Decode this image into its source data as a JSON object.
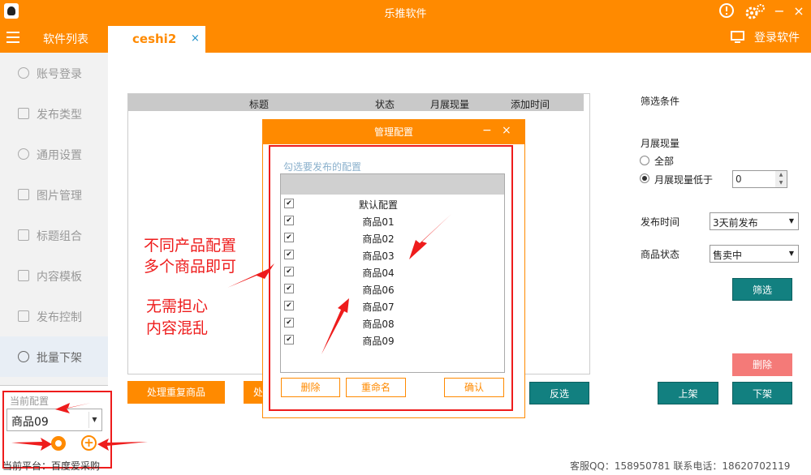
{
  "window": {
    "title": "乐推软件"
  },
  "tabbar": {
    "software_list": "软件列表",
    "active_tab": "ceshi2",
    "tab_close": "×",
    "login": "登录软件"
  },
  "sidebar": {
    "items": [
      {
        "label": "账号登录",
        "icon": "user-icon"
      },
      {
        "label": "发布类型",
        "icon": "list-icon"
      },
      {
        "label": "通用设置",
        "icon": "gear-icon"
      },
      {
        "label": "图片管理",
        "icon": "image-icon"
      },
      {
        "label": "标题组合",
        "icon": "document-icon"
      },
      {
        "label": "内容模板",
        "icon": "template-icon"
      },
      {
        "label": "发布控制",
        "icon": "send-icon"
      },
      {
        "label": "批量下架",
        "icon": "search-icon"
      }
    ],
    "current_config_label": "当前配置",
    "current_config_value": "商品09"
  },
  "table": {
    "columns": [
      "标题",
      "状态",
      "月展现量",
      "添加时间"
    ]
  },
  "buttons": {
    "process_duplicates": "处理重复商品",
    "partial_button": "处",
    "invert": "反选",
    "list_on": "上架",
    "list_off": "下架",
    "delete": "删除",
    "filter": "筛选"
  },
  "filter": {
    "title": "筛选条件",
    "monthly_label": "月展现量",
    "radio_all": "全部",
    "radio_below": "月展现量低于",
    "below_value": "0",
    "publish_time_label": "发布时间",
    "publish_time_value": "3天前发布",
    "product_status_label": "商品状态",
    "product_status_value": "售卖中"
  },
  "dialog": {
    "title": "管理配置",
    "minimize": "−",
    "close": "×",
    "hint": "勾选要发布的配置",
    "configs": [
      "默认配置",
      "商品01",
      "商品02",
      "商品03",
      "商品04",
      "商品06",
      "商品07",
      "商品08",
      "商品09"
    ],
    "btn_delete": "删除",
    "btn_rename": "重命名",
    "btn_confirm": "确认"
  },
  "annotations": {
    "line1": "不同产品配置",
    "line2": "多个商品即可",
    "line3": "无需担心",
    "line4": "内容混乱"
  },
  "footer": {
    "platform": "当前平台：百度爱采购",
    "contact": "客服QQ：158950781   联系电话：18620702119"
  },
  "colors": {
    "accent": "#ff8a00",
    "teal": "#128080",
    "annotation": "#ee1c1c",
    "delete_pink": "#f47a78"
  }
}
